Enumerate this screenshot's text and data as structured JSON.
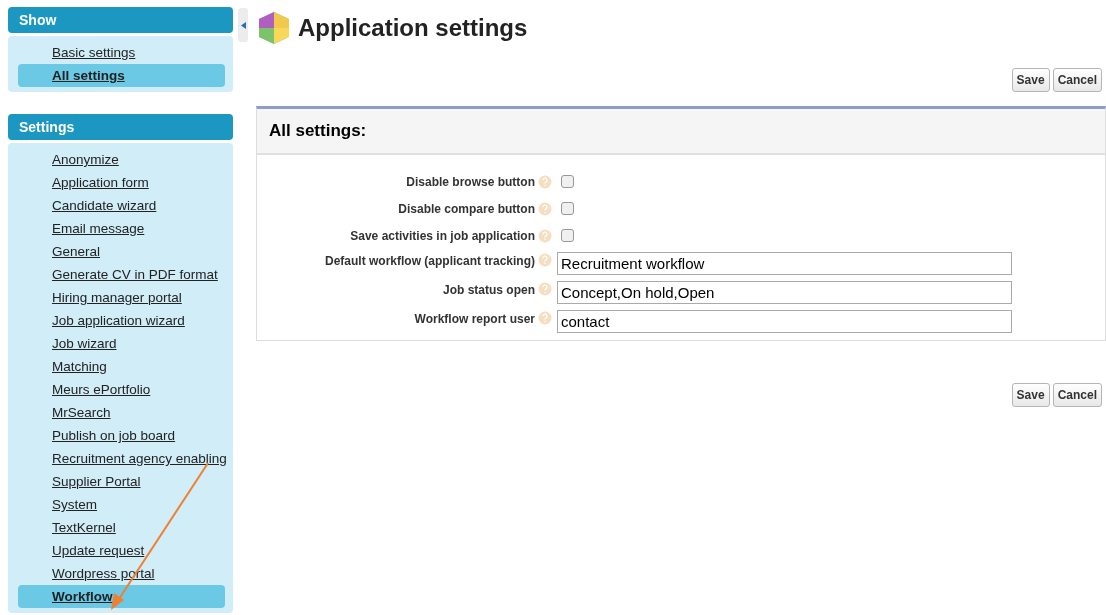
{
  "sidebar": {
    "sections": [
      {
        "title": "Show",
        "items": [
          {
            "label": "Basic settings",
            "selected": false
          },
          {
            "label": "All settings",
            "selected": true
          }
        ]
      },
      {
        "title": "Settings",
        "items": [
          {
            "label": "Anonymize",
            "selected": false
          },
          {
            "label": "Application form",
            "selected": false
          },
          {
            "label": "Candidate wizard",
            "selected": false
          },
          {
            "label": "Email message",
            "selected": false
          },
          {
            "label": "General",
            "selected": false
          },
          {
            "label": "Generate CV in PDF format",
            "selected": false
          },
          {
            "label": "Hiring manager portal",
            "selected": false
          },
          {
            "label": "Job application wizard",
            "selected": false
          },
          {
            "label": "Job wizard",
            "selected": false
          },
          {
            "label": "Matching",
            "selected": false
          },
          {
            "label": "Meurs ePortfolio",
            "selected": false
          },
          {
            "label": "MrSearch",
            "selected": false
          },
          {
            "label": "Publish on job board",
            "selected": false
          },
          {
            "label": "Recruitment agency enabling",
            "selected": false
          },
          {
            "label": "Supplier Portal",
            "selected": false
          },
          {
            "label": "System",
            "selected": false
          },
          {
            "label": "TextKernel",
            "selected": false
          },
          {
            "label": "Update request",
            "selected": false
          },
          {
            "label": "Wordpress portal",
            "selected": false
          },
          {
            "label": "Workflow",
            "selected": true
          }
        ]
      }
    ]
  },
  "page": {
    "title": "Application settings"
  },
  "top_buttons": [
    "Save",
    "Cancel"
  ],
  "panel": {
    "title": "All settings:",
    "fields": [
      {
        "kind": "checkbox",
        "label": "Disable browse button",
        "checked": false
      },
      {
        "kind": "checkbox",
        "label": "Disable compare button",
        "checked": false
      },
      {
        "kind": "checkbox",
        "label": "Save activities in job application",
        "checked": false
      },
      {
        "kind": "text",
        "label": "Default workflow (applicant tracking)",
        "value": "Recruitment workflow"
      },
      {
        "kind": "text",
        "label": "Job status open",
        "value": "Concept,On hold,Open"
      },
      {
        "kind": "text",
        "label": "Workflow report user",
        "value": "contact"
      }
    ]
  },
  "bottom_buttons": [
    "Save",
    "Cancel"
  ]
}
